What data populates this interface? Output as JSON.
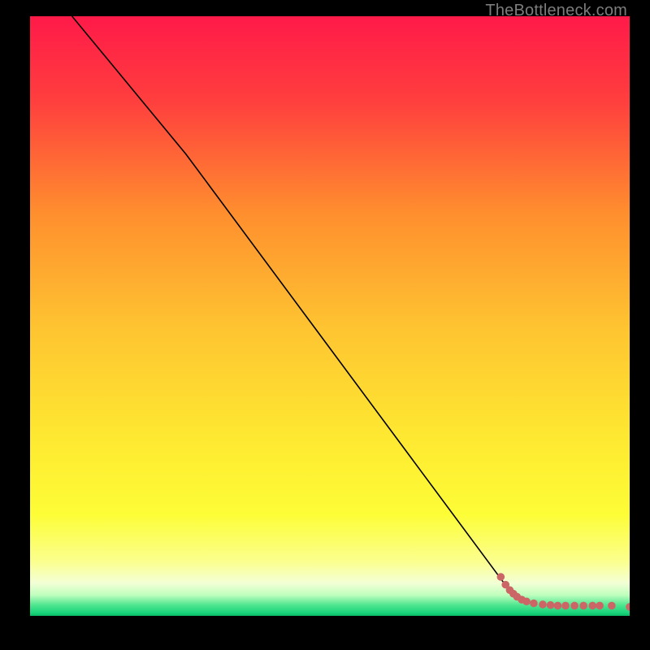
{
  "watermark": "TheBottleneck.com",
  "chart_data": {
    "type": "line",
    "title": "",
    "xlabel": "",
    "ylabel": "",
    "xlim": [
      0,
      100
    ],
    "ylim": [
      0,
      100
    ],
    "gradient_stops": [
      {
        "offset": 0,
        "color": "#ff1a49"
      },
      {
        "offset": 0.14,
        "color": "#ff3e3e"
      },
      {
        "offset": 0.33,
        "color": "#ff8f2e"
      },
      {
        "offset": 0.52,
        "color": "#fec431"
      },
      {
        "offset": 0.7,
        "color": "#fee831"
      },
      {
        "offset": 0.83,
        "color": "#fdfd36"
      },
      {
        "offset": 0.91,
        "color": "#fbff8f"
      },
      {
        "offset": 0.945,
        "color": "#f3ffd6"
      },
      {
        "offset": 0.965,
        "color": "#c0ffbe"
      },
      {
        "offset": 0.982,
        "color": "#4fe58f"
      },
      {
        "offset": 0.995,
        "color": "#18d47b"
      },
      {
        "offset": 1.0,
        "color": "#0cb964"
      }
    ],
    "series": [
      {
        "name": "bottleneck-curve",
        "type": "line",
        "color": "#000000",
        "x": [
          7,
          26,
          80.5
        ],
        "y": [
          100,
          77,
          3.5
        ]
      },
      {
        "name": "data-points",
        "type": "scatter",
        "color": "#cc6666",
        "points": [
          {
            "x": 78.5,
            "y": 6.5
          },
          {
            "x": 79.3,
            "y": 5.2
          },
          {
            "x": 80.0,
            "y": 4.3
          },
          {
            "x": 80.6,
            "y": 3.7
          },
          {
            "x": 81.2,
            "y": 3.2
          },
          {
            "x": 82.0,
            "y": 2.7
          },
          {
            "x": 82.8,
            "y": 2.4
          },
          {
            "x": 84.0,
            "y": 2.1
          },
          {
            "x": 85.5,
            "y": 1.9
          },
          {
            "x": 86.8,
            "y": 1.8
          },
          {
            "x": 88.0,
            "y": 1.7
          },
          {
            "x": 89.3,
            "y": 1.7
          },
          {
            "x": 90.8,
            "y": 1.7
          },
          {
            "x": 92.3,
            "y": 1.7
          },
          {
            "x": 93.8,
            "y": 1.7
          },
          {
            "x": 95.0,
            "y": 1.7
          },
          {
            "x": 97.0,
            "y": 1.7
          },
          {
            "x": 100.0,
            "y": 1.5
          }
        ]
      }
    ]
  }
}
